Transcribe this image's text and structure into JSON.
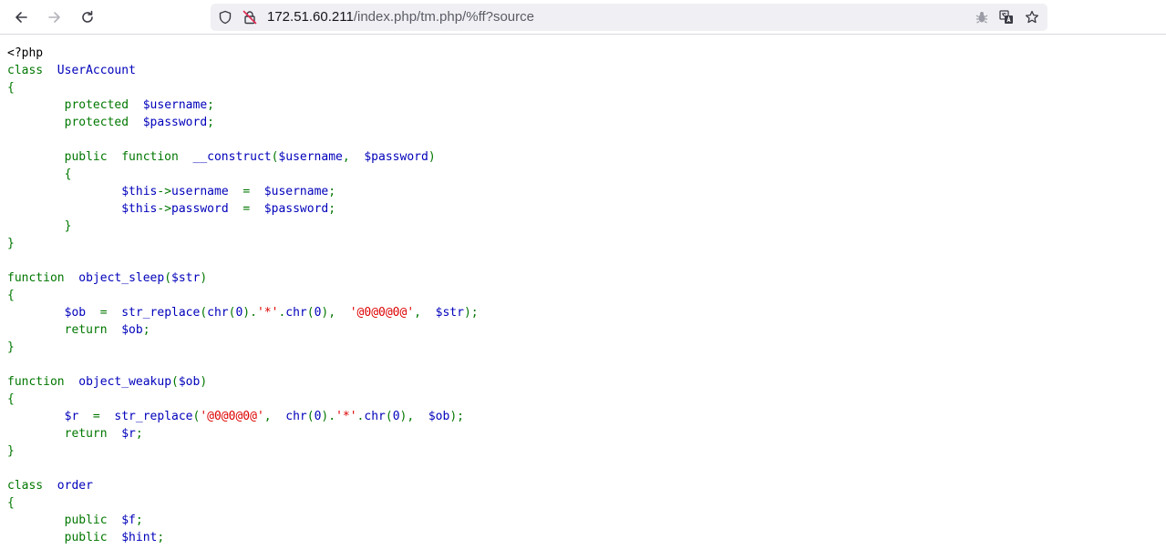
{
  "browser": {
    "back_icon": "arrow-left-icon",
    "forward_icon": "arrow-right-icon",
    "reload_icon": "reload-icon",
    "shield_icon": "tracking-protection-shield-icon",
    "lock_icon": "insecure-connection-lock-icon",
    "url_host": "172.51.60.211",
    "url_path": "/index.php/tm.php/%ff?source",
    "extension_icon": "bug-extension-icon",
    "translate_icon": "translate-icon",
    "bookmark_icon": "star-bookmark-icon"
  },
  "colors": {
    "keyword": "#007700",
    "identifier": "#0000bb",
    "string": "#dd0000",
    "default": "#000000"
  },
  "source": {
    "lines": [
      [
        {
          "t": "def",
          "s": "<?php"
        }
      ],
      [
        {
          "t": "kw",
          "s": "class  "
        },
        {
          "t": "id",
          "s": "UserAccount"
        }
      ],
      [
        {
          "t": "kw",
          "s": "{"
        }
      ],
      [
        {
          "t": "kw",
          "s": "        protected  "
        },
        {
          "t": "id",
          "s": "$username"
        },
        {
          "t": "kw",
          "s": ";"
        }
      ],
      [
        {
          "t": "kw",
          "s": "        protected  "
        },
        {
          "t": "id",
          "s": "$password"
        },
        {
          "t": "kw",
          "s": ";"
        }
      ],
      [],
      [
        {
          "t": "kw",
          "s": "        public  function  "
        },
        {
          "t": "id",
          "s": "__construct"
        },
        {
          "t": "kw",
          "s": "("
        },
        {
          "t": "id",
          "s": "$username"
        },
        {
          "t": "kw",
          "s": ",  "
        },
        {
          "t": "id",
          "s": "$password"
        },
        {
          "t": "kw",
          "s": ")"
        }
      ],
      [
        {
          "t": "kw",
          "s": "        {"
        }
      ],
      [
        {
          "t": "id",
          "s": "                $this"
        },
        {
          "t": "kw",
          "s": "->"
        },
        {
          "t": "id",
          "s": "username  "
        },
        {
          "t": "kw",
          "s": "=  "
        },
        {
          "t": "id",
          "s": "$username"
        },
        {
          "t": "kw",
          "s": ";"
        }
      ],
      [
        {
          "t": "id",
          "s": "                $this"
        },
        {
          "t": "kw",
          "s": "->"
        },
        {
          "t": "id",
          "s": "password  "
        },
        {
          "t": "kw",
          "s": "=  "
        },
        {
          "t": "id",
          "s": "$password"
        },
        {
          "t": "kw",
          "s": ";"
        }
      ],
      [
        {
          "t": "kw",
          "s": "        }"
        }
      ],
      [
        {
          "t": "kw",
          "s": "}"
        }
      ],
      [],
      [
        {
          "t": "kw",
          "s": "function  "
        },
        {
          "t": "id",
          "s": "object_sleep"
        },
        {
          "t": "kw",
          "s": "("
        },
        {
          "t": "id",
          "s": "$str"
        },
        {
          "t": "kw",
          "s": ")"
        }
      ],
      [
        {
          "t": "kw",
          "s": "{"
        }
      ],
      [
        {
          "t": "id",
          "s": "        $ob  "
        },
        {
          "t": "kw",
          "s": "=  "
        },
        {
          "t": "id",
          "s": "str_replace"
        },
        {
          "t": "kw",
          "s": "("
        },
        {
          "t": "id",
          "s": "chr"
        },
        {
          "t": "kw",
          "s": "("
        },
        {
          "t": "id",
          "s": "0"
        },
        {
          "t": "kw",
          "s": ")."
        },
        {
          "t": "str",
          "s": "'*'"
        },
        {
          "t": "kw",
          "s": "."
        },
        {
          "t": "id",
          "s": "chr"
        },
        {
          "t": "kw",
          "s": "("
        },
        {
          "t": "id",
          "s": "0"
        },
        {
          "t": "kw",
          "s": "),  "
        },
        {
          "t": "str",
          "s": "'@0@0@0@'"
        },
        {
          "t": "kw",
          "s": ",  "
        },
        {
          "t": "id",
          "s": "$str"
        },
        {
          "t": "kw",
          "s": ");"
        }
      ],
      [
        {
          "t": "kw",
          "s": "        return  "
        },
        {
          "t": "id",
          "s": "$ob"
        },
        {
          "t": "kw",
          "s": ";"
        }
      ],
      [
        {
          "t": "kw",
          "s": "}"
        }
      ],
      [],
      [
        {
          "t": "kw",
          "s": "function  "
        },
        {
          "t": "id",
          "s": "object_weakup"
        },
        {
          "t": "kw",
          "s": "("
        },
        {
          "t": "id",
          "s": "$ob"
        },
        {
          "t": "kw",
          "s": ")"
        }
      ],
      [
        {
          "t": "kw",
          "s": "{"
        }
      ],
      [
        {
          "t": "id",
          "s": "        $r  "
        },
        {
          "t": "kw",
          "s": "=  "
        },
        {
          "t": "id",
          "s": "str_replace"
        },
        {
          "t": "kw",
          "s": "("
        },
        {
          "t": "str",
          "s": "'@0@0@0@'"
        },
        {
          "t": "kw",
          "s": ",  "
        },
        {
          "t": "id",
          "s": "chr"
        },
        {
          "t": "kw",
          "s": "("
        },
        {
          "t": "id",
          "s": "0"
        },
        {
          "t": "kw",
          "s": ")."
        },
        {
          "t": "str",
          "s": "'*'"
        },
        {
          "t": "kw",
          "s": "."
        },
        {
          "t": "id",
          "s": "chr"
        },
        {
          "t": "kw",
          "s": "("
        },
        {
          "t": "id",
          "s": "0"
        },
        {
          "t": "kw",
          "s": "),  "
        },
        {
          "t": "id",
          "s": "$ob"
        },
        {
          "t": "kw",
          "s": ");"
        }
      ],
      [
        {
          "t": "kw",
          "s": "        return  "
        },
        {
          "t": "id",
          "s": "$r"
        },
        {
          "t": "kw",
          "s": ";"
        }
      ],
      [
        {
          "t": "kw",
          "s": "}"
        }
      ],
      [],
      [
        {
          "t": "kw",
          "s": "class  "
        },
        {
          "t": "id",
          "s": "order"
        }
      ],
      [
        {
          "t": "kw",
          "s": "{"
        }
      ],
      [
        {
          "t": "kw",
          "s": "        public  "
        },
        {
          "t": "id",
          "s": "$f"
        },
        {
          "t": "kw",
          "s": ";"
        }
      ],
      [
        {
          "t": "kw",
          "s": "        public  "
        },
        {
          "t": "id",
          "s": "$hint"
        },
        {
          "t": "kw",
          "s": ";"
        }
      ]
    ]
  }
}
